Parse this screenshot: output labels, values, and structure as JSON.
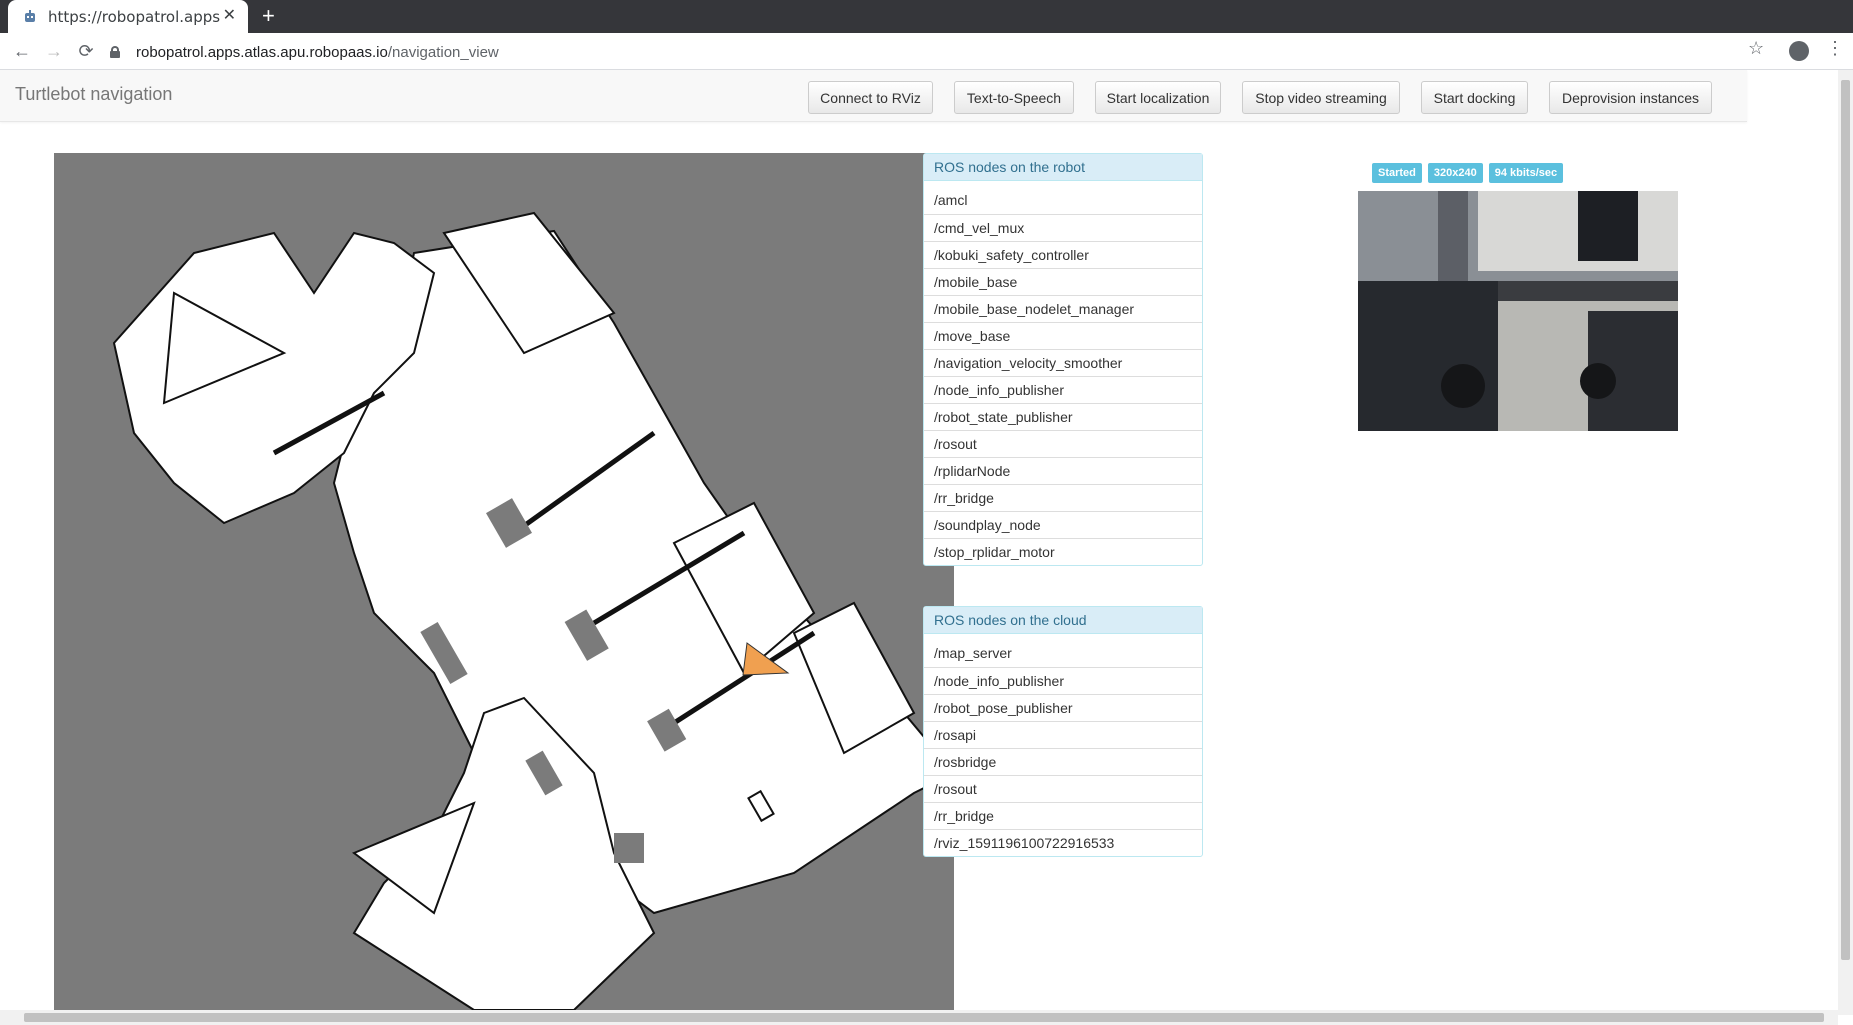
{
  "browser": {
    "tab_title": "https://robopatrol.apps.a",
    "tab_close": "✕",
    "new_tab": "+",
    "url_host": "robopatrol.apps.atlas.apu.robopaas.io",
    "url_path": "/navigation_view",
    "icons": {
      "back": "←",
      "forward": "→",
      "reload": "⟳",
      "star": "☆",
      "menu": "⋮"
    }
  },
  "navbar": {
    "brand": "Turtlebot navigation",
    "buttons": {
      "connect_rviz": "Connect to RViz",
      "tts": "Text-to-Speech",
      "start_localization": "Start localization",
      "stop_video": "Stop video streaming",
      "start_docking": "Start docking",
      "deprovision": "Deprovision instances"
    }
  },
  "robot_nodes": {
    "title": "ROS nodes on the robot",
    "items": [
      "/amcl",
      "/cmd_vel_mux",
      "/kobuki_safety_controller",
      "/mobile_base",
      "/mobile_base_nodelet_manager",
      "/move_base",
      "/navigation_velocity_smoother",
      "/node_info_publisher",
      "/robot_state_publisher",
      "/rosout",
      "/rplidarNode",
      "/rr_bridge",
      "/soundplay_node",
      "/stop_rplidar_motor"
    ]
  },
  "cloud_nodes": {
    "title": "ROS nodes on the cloud",
    "items": [
      "/map_server",
      "/node_info_publisher",
      "/robot_pose_publisher",
      "/rosapi",
      "/rosbridge",
      "/rosout",
      "/rr_bridge",
      "/rviz_1591196100722916533"
    ]
  },
  "video": {
    "status": "Started",
    "resolution": "320x240",
    "bitrate": "94 kbits/sec"
  },
  "colors": {
    "map_unknown": "#7b7b7b",
    "map_free": "#ffffff",
    "robot_marker": "#f0a050",
    "panel_heading_bg": "#d9edf7",
    "badge": "#5bc0de"
  }
}
